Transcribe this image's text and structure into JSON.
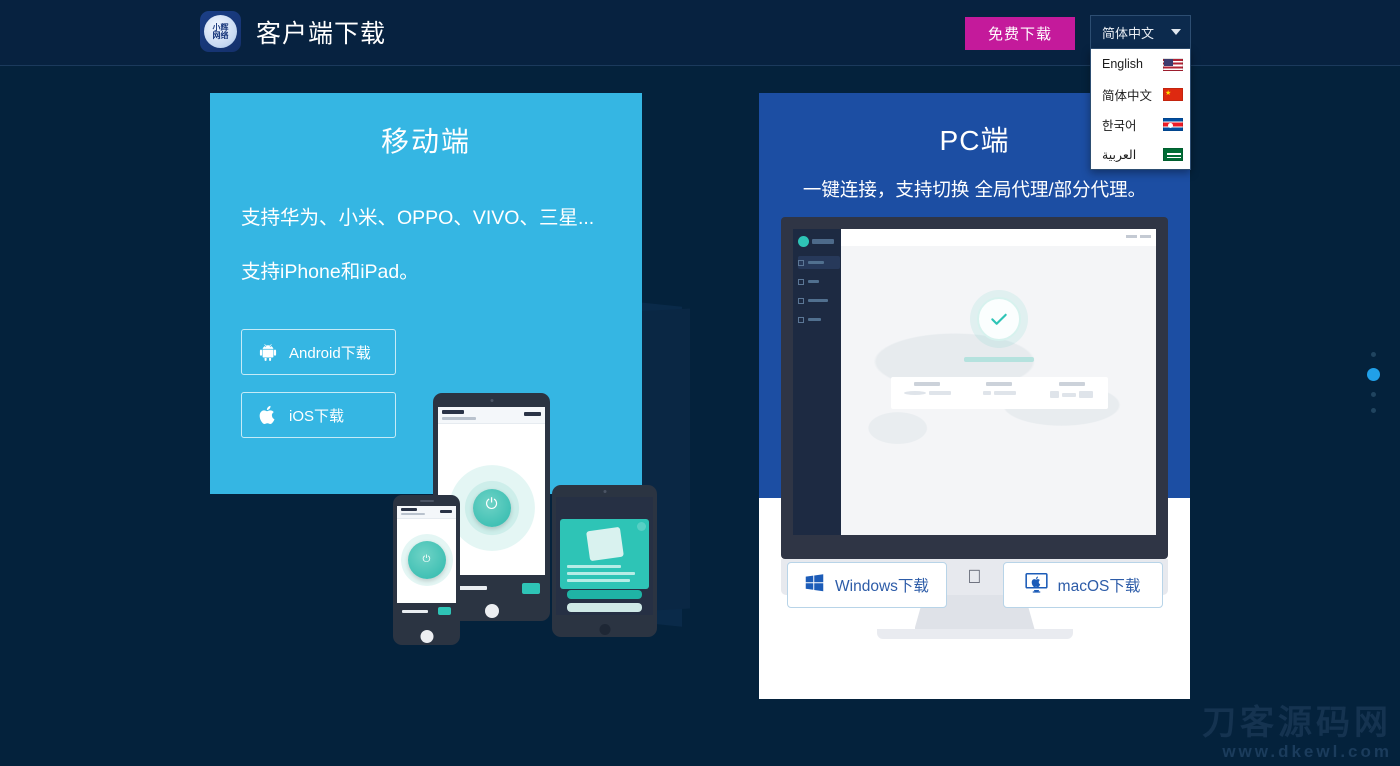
{
  "header": {
    "logo_lines": [
      "小辉",
      "网络"
    ],
    "title": "客户端下载",
    "free_download_label": "免费下载",
    "language": {
      "selected": "简体中文",
      "caret_icon": "chevron-down-icon",
      "options": [
        {
          "label": "English",
          "flag": "us"
        },
        {
          "label": "简体中文",
          "flag": "cn"
        },
        {
          "label": "한국어",
          "flag": "kp"
        },
        {
          "label": "العربية",
          "flag": "sa"
        }
      ]
    }
  },
  "mobile_card": {
    "title": "移动端",
    "desc1": "支持华为、小米、OPPO、VIVO、三星...",
    "desc2": "支持iPhone和iPad。",
    "buttons": [
      {
        "label": "Android下载",
        "icon": "android-icon"
      },
      {
        "label": "iOS下载",
        "icon": "apple-icon"
      }
    ]
  },
  "pc_card": {
    "title": "PC端",
    "subtitle": "一键连接，支持切换 全局代理/部分代理。",
    "buttons": [
      {
        "label": "Windows下载",
        "icon": "windows-icon"
      },
      {
        "label": "macOS下载",
        "icon": "imac-icon"
      }
    ]
  },
  "carousel": {
    "count": 4,
    "active_index": 1
  },
  "watermark": {
    "line1": "刀客源码网",
    "line2": "www.dkewl.com"
  },
  "colors": {
    "background": "#04223c",
    "header": "#072240",
    "accent_magenta": "#c41a9b",
    "mobile_card": "#35b6e3",
    "pc_card_header": "#1c4ea3",
    "dot_active": "#21a0e8",
    "button_blue_text": "#2d5ca8"
  }
}
